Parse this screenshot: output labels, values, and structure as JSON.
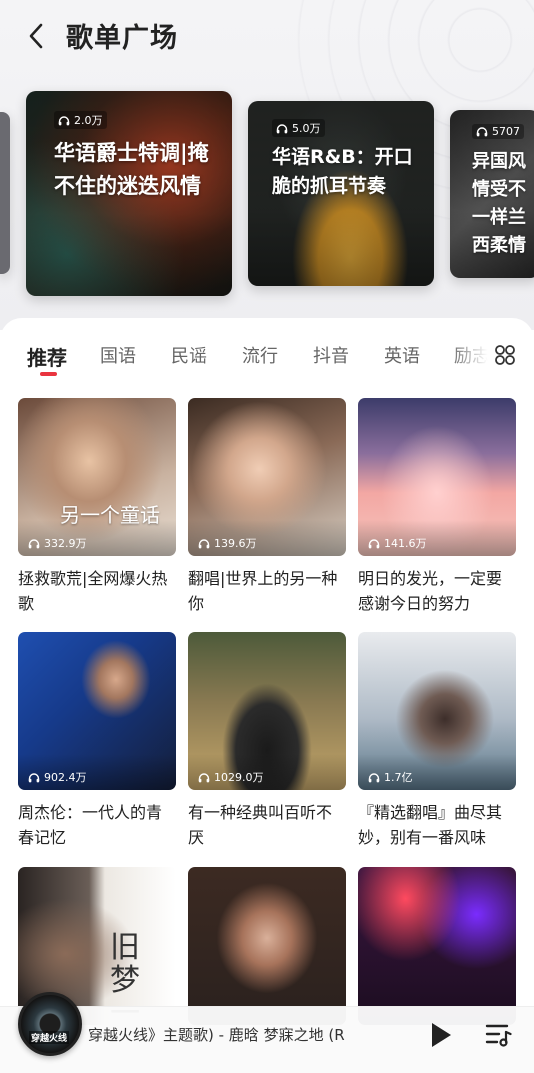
{
  "header": {
    "title": "歌单广场"
  },
  "carousel": [
    {
      "play_count": "2.0万",
      "title": "华语爵士特调|掩不住的迷迭风情"
    },
    {
      "play_count": "5.0万",
      "title": "华语R&B：开口脆的抓耳节奏"
    },
    {
      "play_count": "5707",
      "title": "异国风情受不一样兰西柔情"
    }
  ],
  "tabs": [
    {
      "label": "推荐",
      "active": true
    },
    {
      "label": "国语"
    },
    {
      "label": "民谣"
    },
    {
      "label": "流行"
    },
    {
      "label": "抖音"
    },
    {
      "label": "英语"
    },
    {
      "label": "励志"
    }
  ],
  "playlists": [
    {
      "title": "拯救歌荒|全网爆火热歌",
      "play_count": "332.9万",
      "cover_text": "另一个童话"
    },
    {
      "title": "翻唱|世界上的另一种你",
      "play_count": "139.6万"
    },
    {
      "title": "明日的发光，一定要感谢今日的努力",
      "play_count": "141.6万"
    },
    {
      "title": "周杰伦：一代人的青春记忆",
      "play_count": "902.4万"
    },
    {
      "title": "有一种经典叫百听不厌",
      "play_count": "1029.0万"
    },
    {
      "title": "『精选翻唱』曲尽其妙，别有一番风味",
      "play_count": "1.7亿"
    },
    {
      "title": "",
      "play_count": "",
      "cover_text": "旧梦一场"
    },
    {
      "title": "",
      "play_count": ""
    },
    {
      "title": "",
      "play_count": ""
    }
  ],
  "player": {
    "disc_label": "穿越火线",
    "track_text": "穿越火线》主题歌) - 鹿晗    梦寐之地 (R"
  },
  "icons": {
    "back": "chevron-left-icon",
    "grid": "grid-icon",
    "headphones": "headphones-icon",
    "play": "play-icon",
    "playlist": "playlist-icon"
  },
  "colors": {
    "accent": "#e9343f"
  }
}
